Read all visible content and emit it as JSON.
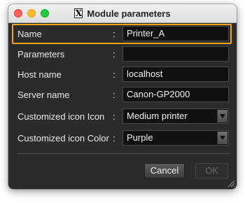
{
  "window": {
    "title": "Module parameters",
    "title_icon": "X",
    "accent_color": "#f4a51c"
  },
  "form": {
    "colon": ":",
    "rows": [
      {
        "label": "Name",
        "value": "Printer_A",
        "kind": "text"
      },
      {
        "label": "Parameters",
        "value": "",
        "kind": "text"
      },
      {
        "label": "Host name",
        "value": "localhost",
        "kind": "text"
      },
      {
        "label": "Server name",
        "value": "Canon-GP2000",
        "kind": "text"
      },
      {
        "label": "Customized icon Icon",
        "value": "Medium printer",
        "kind": "select"
      },
      {
        "label": "Customized icon Color",
        "value": "Purple",
        "kind": "select"
      }
    ]
  },
  "buttons": {
    "cancel": "Cancel",
    "ok": "OK"
  }
}
